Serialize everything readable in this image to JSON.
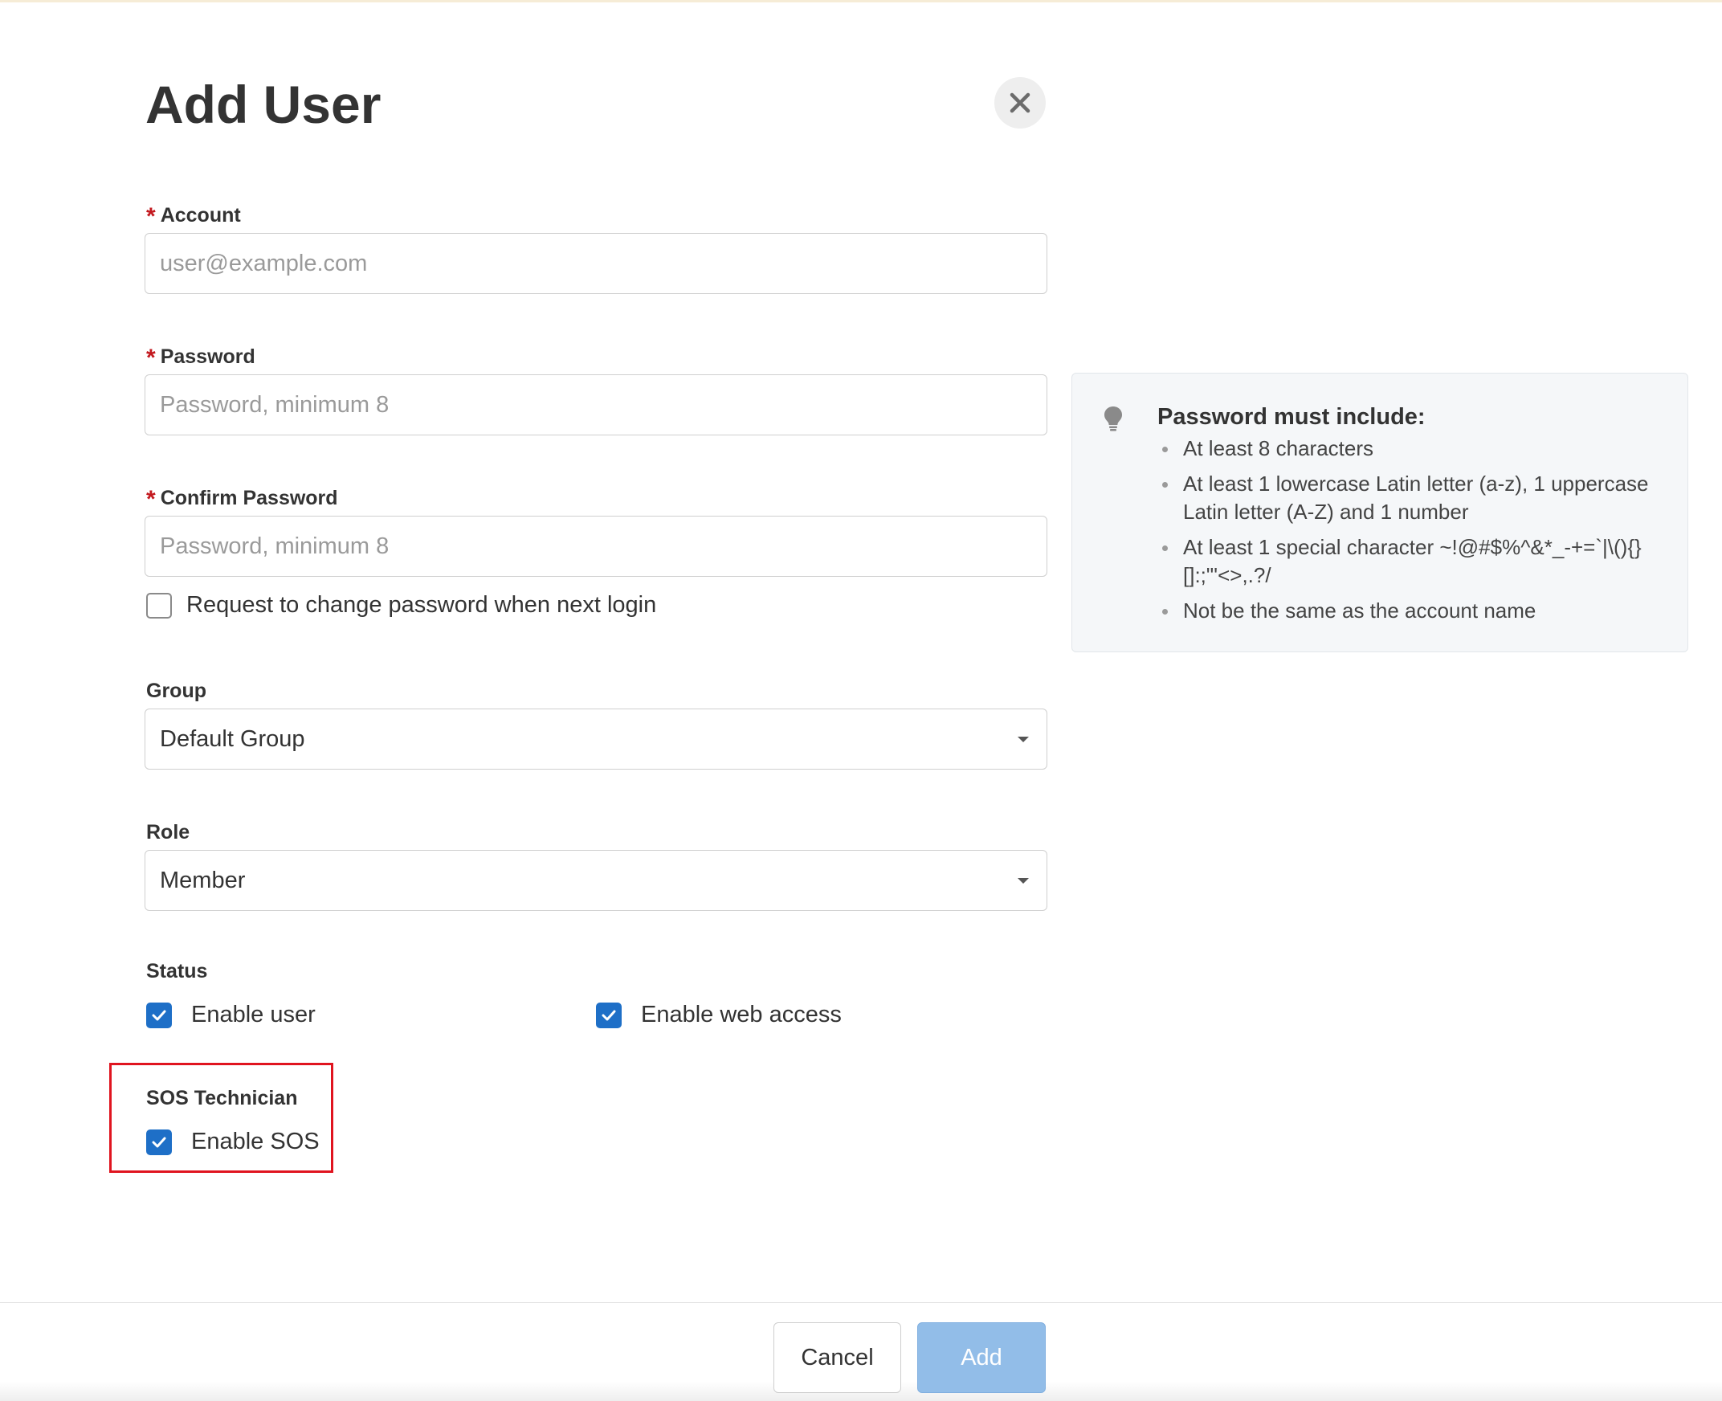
{
  "dialog": {
    "title": "Add User",
    "close_icon": "close-icon"
  },
  "form": {
    "account": {
      "label": "Account",
      "required_mark": "*",
      "value": "",
      "placeholder": "user@example.com"
    },
    "password": {
      "label": "Password",
      "required_mark": "*",
      "value": "",
      "placeholder": "Password, minimum 8"
    },
    "confirm_password": {
      "label": "Confirm Password",
      "required_mark": "*",
      "value": "",
      "placeholder": "Password, minimum 8"
    },
    "change_password_checkbox": {
      "label": "Request to change password when next login",
      "checked": false
    },
    "group": {
      "label": "Group",
      "selected": "Default Group"
    },
    "role": {
      "label": "Role",
      "selected": "Member"
    },
    "status": {
      "label": "Status",
      "enable_user": {
        "label": "Enable user",
        "checked": true
      },
      "enable_web_access": {
        "label": "Enable web access",
        "checked": true
      }
    },
    "sos": {
      "label": "SOS Technician",
      "enable_sos": {
        "label": "Enable SOS",
        "checked": true
      }
    }
  },
  "password_tips": {
    "icon": "lightbulb-icon",
    "title": "Password must include:",
    "items": [
      "At least 8 characters",
      "At least 1 lowercase Latin letter (a-z), 1 uppercase Latin letter (A-Z) and 1 number",
      "At least 1 special character ~!@#$%^&*_-+=`|\\(){}[]:;\"'<>,.?/",
      "Not be the same as the account name"
    ]
  },
  "footer": {
    "cancel_label": "Cancel",
    "add_label": "Add"
  },
  "colors": {
    "accent": "#1e6fc7",
    "required": "#c3191f",
    "highlight": "#e0141f",
    "add_button_disabled": "#92bde8"
  }
}
